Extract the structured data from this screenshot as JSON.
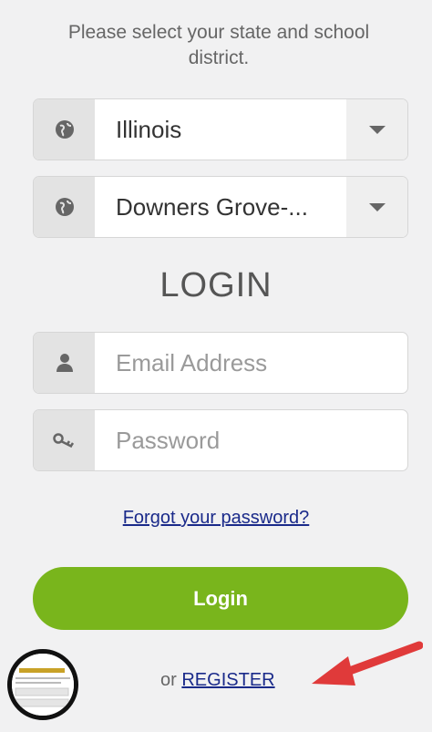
{
  "instructions": "Please select your state and school district.",
  "state_select": {
    "value": "Illinois",
    "icon": "globe-icon"
  },
  "district_select": {
    "value": "Downers Grove-...",
    "icon": "globe-icon"
  },
  "login_heading": "LOGIN",
  "email_field": {
    "placeholder": "Email Address",
    "icon": "user-icon"
  },
  "password_field": {
    "placeholder": "Password",
    "icon": "key-icon"
  },
  "forgot_link": "Forgot your password?",
  "login_button": "Login",
  "register": {
    "prefix": "or",
    "link": "REGISTER"
  },
  "colors": {
    "accent_green": "#79b51c",
    "link_blue": "#1a2a8a",
    "arrow_red": "#e03a3a"
  }
}
